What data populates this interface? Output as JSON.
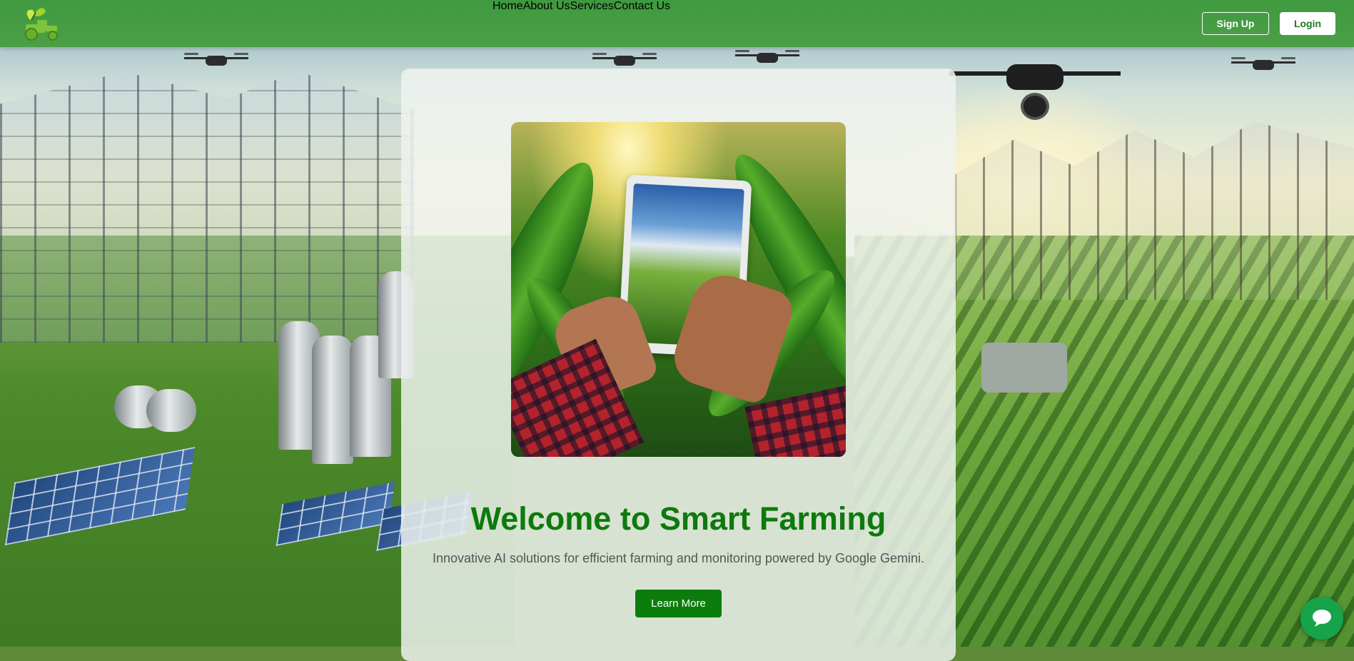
{
  "header": {
    "logo_name": "tractor-leaf-logo",
    "nav": [
      {
        "label": "Home"
      },
      {
        "label": "About Us"
      },
      {
        "label": "Services"
      },
      {
        "label": "Contact Us"
      }
    ],
    "signup_label": "Sign Up",
    "login_label": "Login"
  },
  "hero": {
    "title": "Welcome to Smart Farming",
    "subtitle": "Innovative AI solutions for efficient farming and monitoring powered by Google Gemini.",
    "cta_label": "Learn More"
  },
  "chat": {
    "icon": "chat-bubble-icon"
  },
  "colors": {
    "header": "#4c9f46",
    "accent": "#0c7d0c",
    "title": "#0d7a0d",
    "chat": "#16a34a"
  }
}
